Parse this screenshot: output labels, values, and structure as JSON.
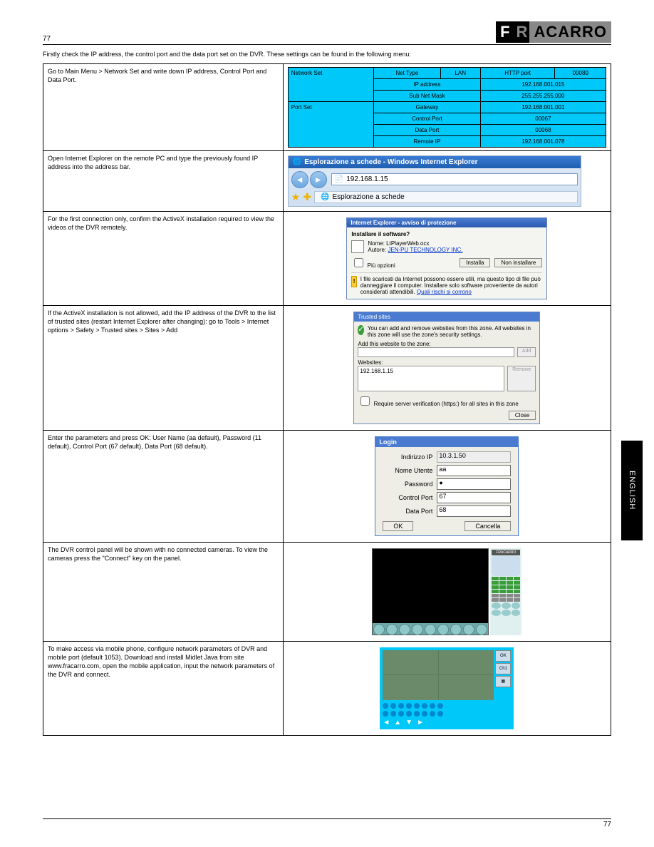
{
  "header": {
    "page_top": "77",
    "logo": "FRACARRO"
  },
  "side_tab": "ENGLISH",
  "intro": "Firstly check the IP address, the control port and the data port set on the DVR. These settings can be found in the following menu:",
  "steps": {
    "s1": {
      "left": "Go to Main Menu > Network Set and write down IP address, Control Port and Data Port.",
      "net": {
        "section1": "Network Set",
        "r1": [
          "Net Type",
          "LAN",
          "HTTP port",
          "00080"
        ],
        "r2a": "IP address",
        "r2b": "192.168.001.015",
        "r3a": "Sub Net Mask",
        "r3b": "255.255.255.000",
        "section2": "Port Set",
        "r4a": "Gateway",
        "r4b": "192.168.001.001",
        "r5a": "Control Port",
        "r5b": "00067",
        "r6a": "Data Port",
        "r6b": "00068",
        "r7a": "Remote IP",
        "r7b": "192.168.001.078"
      }
    },
    "s2": {
      "left": "Open Internet Explorer on the remote PC and type the previously found IP address into the address bar.",
      "title": "Esplorazione a schede - Windows Internet Explorer",
      "addr": "192.168.1.15",
      "tab": "Esplorazione a schede"
    },
    "s3": {
      "left": "For the first connection only, confirm the ActiveX installation required to view the videos of the DVR remotely.",
      "dlg_title": "Internet Explorer - avviso di protezione",
      "dlg_q": "Installare il software?",
      "dlg_name_l": "Nome:",
      "dlg_name_v": "LtPlayerWeb.ocx",
      "dlg_auth_l": "Autore:",
      "dlg_auth_v": "JEN-PU TECHNOLOGY INC.",
      "dlg_more": "Più opzioni",
      "dlg_inst": "Installa",
      "dlg_noinst": "Non installare",
      "dlg_warn": "I file scaricati da Internet possono essere utili, ma questo tipo di file può danneggiare il computer. Installare solo software proveniente da autori considerati attendibili.",
      "dlg_warn_link": "Quali rischi si corrono"
    },
    "s4": {
      "left": "If the ActiveX installation is not allowed, add the IP address of the DVR to the list of trusted sites (restart Internet Explorer after changing): go to Tools > Internet options > Safety > Trusted sites > Sites > Add",
      "ts_title": "Trusted sites",
      "ts_desc": "You can add and remove websites from this zone. All websites in this zone will use the zone's security settings.",
      "ts_add_l": "Add this website to the zone:",
      "ts_add_btn": "Add",
      "ts_list_l": "Websites:",
      "ts_item": "192.168.1.15",
      "ts_rem": "Remove",
      "ts_req": "Require server verification (https:) for all sites in this zone",
      "ts_close": "Close"
    },
    "s5": {
      "left": "Enter the parameters and press OK: User Name (aa default), Password (11 default), Control Port (67 default), Data Port (68 default).",
      "title": "Login",
      "ip_l": "Indirizzo IP",
      "ip_v": "10.3.1.50",
      "user_l": "Nome Utente",
      "user_v": "aa",
      "pass_l": "Password",
      "pass_v": "●",
      "cport_l": "Control Port",
      "cport_v": "67",
      "dport_l": "Data Port",
      "dport_v": "68",
      "ok": "OK",
      "cancel": "Cancella"
    },
    "s6": {
      "left": "The DVR control panel will be shown with no connected cameras. To view the cameras press the \"Connect\" key on the panel.",
      "logo": "FRACARRO"
    },
    "s7": {
      "left": "To make access via mobile phone, configure network parameters of DVR and mobile port (default 1053). Download and install Midlet Java from site www.fracarro.com, open the mobile application, input the network parameters of the DVR and connect.",
      "btn1": "OK",
      "btn2": "Ch1"
    }
  },
  "footer": {
    "page_bottom": "77"
  }
}
